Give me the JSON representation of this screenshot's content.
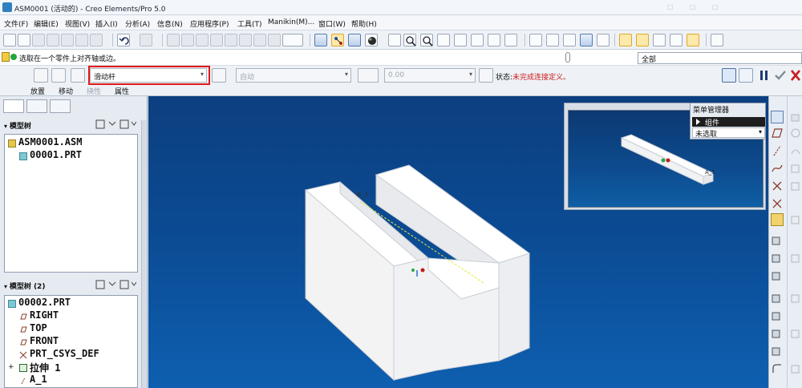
{
  "window": {
    "title": "ASM0001 (活动的) - Creo Elements/Pro 5.0",
    "faint_items": [
      "□",
      "□",
      "□"
    ]
  },
  "menu": {
    "items": [
      "文件(F)",
      "编辑(E)",
      "视图(V)",
      "插入(I)",
      "分析(A)",
      "信息(N)",
      "应用程序(P)",
      "工具(T)",
      "Manikin(M)...",
      "窗口(W)",
      "帮助(H)"
    ]
  },
  "prompt": {
    "message": "选取在一个零件上对齐轴或边。",
    "filter_value": "全部"
  },
  "dashboard": {
    "connection_type": "滑动杆",
    "constraint_type": "自动",
    "offset_value": "0.00",
    "status_label": "状态:",
    "status_value": "未完成连接定义。",
    "tabs": [
      "放置",
      "移动",
      "挠性",
      "属性"
    ]
  },
  "left_panel": {
    "model_tree_1": {
      "header": "模型树",
      "items": [
        "ASM0001.ASM",
        "00001.PRT"
      ]
    },
    "model_tree_2": {
      "header": "模型树 (2)",
      "items": [
        "00002.PRT",
        "RIGHT",
        "TOP",
        "FRONT",
        "PRT_CSYS_DEF",
        "拉伸 1",
        "A_1"
      ]
    }
  },
  "viewport": {
    "axis_label": "A_1",
    "preview_axis_label": "A_1"
  },
  "menu_manager": {
    "title": "菜单管理器",
    "active_item": "组件",
    "dropdown_value": "未选取"
  },
  "colors": {
    "status_incomplete": "#d11c1c",
    "highlight_box": "#e01a1a",
    "viewport_bg_top": "#0c3f80",
    "viewport_bg_bottom": "#0e5fb0",
    "model_face": "#f2f2f2"
  },
  "icons": [
    "new-icon",
    "open-icon",
    "save-icon",
    "print-icon",
    "undo-icon",
    "redo-icon",
    "cut-icon",
    "copy-icon",
    "paste-icon",
    "regenerate-icon",
    "zoom-in-icon",
    "zoom-out-icon",
    "refit-icon",
    "shading-icon",
    "spin-center-icon",
    "datum-plane-icon",
    "datum-axis-icon",
    "datum-point-icon",
    "csys-icon",
    "help-icon",
    "pause-icon",
    "preview-icon",
    "ok-check-icon",
    "cancel-x-icon"
  ]
}
